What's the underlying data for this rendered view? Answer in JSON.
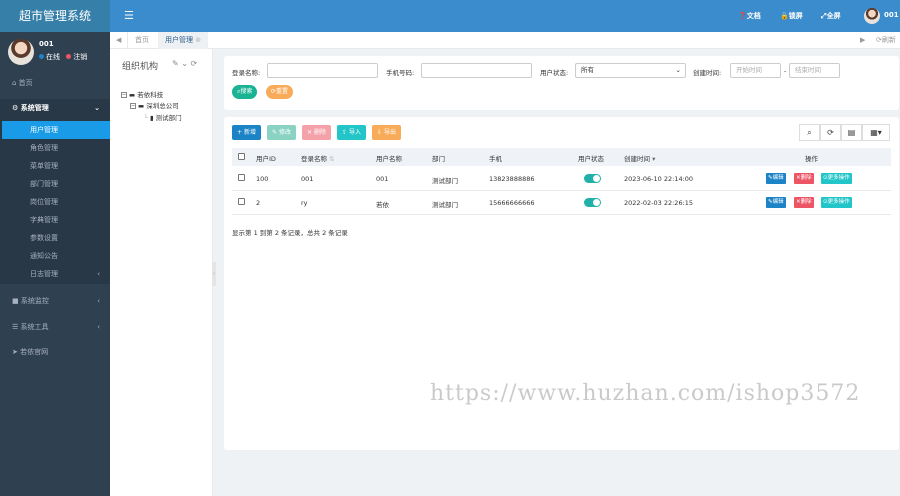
{
  "app": {
    "title": "超市管理系统"
  },
  "profile": {
    "name": "001",
    "status_online": "在线",
    "logout": "注销"
  },
  "sidebar": {
    "home": "首页",
    "system_group": "系统管理",
    "items": [
      "用户管理",
      "角色管理",
      "菜单管理",
      "部门管理",
      "岗位管理",
      "字典管理",
      "参数设置",
      "通知公告",
      "日志管理"
    ],
    "monitor": "系统监控",
    "tools": "系统工具",
    "website": "若依官网"
  },
  "topbar": {
    "docs": "文档",
    "lock": "锁屏",
    "fullscreen": "全屏",
    "user": "001"
  },
  "tabs": {
    "home": "首页",
    "current": "用户管理",
    "refresh": "刷新"
  },
  "org": {
    "title": "组织机构",
    "tree": {
      "root": "若依科技",
      "child": "深圳总公司",
      "leaf": "测试部门"
    }
  },
  "search": {
    "login_name_label": "登录名称:",
    "phone_label": "手机号码:",
    "status_label": "用户状态:",
    "status_value": "所有",
    "created_label": "创建时间:",
    "start_placeholder": "开始时间",
    "sep": "-",
    "end_placeholder": "结束时间",
    "search_btn": "搜索",
    "reset_btn": "重置"
  },
  "toolbar": {
    "add": "新增",
    "edit": "修改",
    "delete": "删除",
    "import": "导入",
    "export": "导出"
  },
  "table": {
    "headers": [
      "用户ID",
      "登录名称",
      "用户名称",
      "部门",
      "手机",
      "用户状态",
      "创建时间",
      "操作"
    ],
    "rows": [
      {
        "id": "100",
        "login": "001",
        "name": "001",
        "dept": "测试部门",
        "phone": "13823888886",
        "created": "2023-06-10 22:14:00"
      },
      {
        "id": "2",
        "login": "ry",
        "name": "若依",
        "dept": "测试部门",
        "phone": "15666666666",
        "created": "2022-02-03 22:26:15"
      }
    ],
    "actions": {
      "edit": "编辑",
      "delete": "删除",
      "more": "更多操作"
    },
    "footer": "显示第 1 到第 2 条记录，总共 2 条记录"
  },
  "watermark": "https://www.huzhan.com/ishop3572",
  "colors": {
    "sidebar": "#2f4050",
    "topbar": "#3a8ccc",
    "active": "#1a9be8",
    "primary": "#1c84c6",
    "success": "#1ab394",
    "danger": "#ed5565"
  }
}
